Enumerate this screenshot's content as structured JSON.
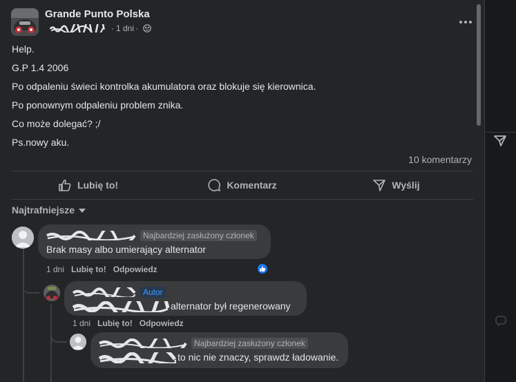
{
  "post": {
    "group_name": "Grande Punto Polska",
    "time": "1 dni",
    "separator": "·",
    "lines": [
      "Help.",
      "G.P 1.4 2006",
      "Po odpaleniu świeci kontrolka akumulatora oraz blokuje się kierownica.",
      "Po ponownym odpaleniu problem znika.",
      "Co może dolegać? ;/",
      "Ps.nowy aku."
    ],
    "comment_count": "10 komentarzy"
  },
  "actions": {
    "like": "Lubię to!",
    "comment": "Komentarz",
    "share": "Wyślij"
  },
  "sort_label": "Najtrafniejsze",
  "comments": [
    {
      "badge": "Najbardziej zasłużony członek",
      "text": "Brak masy albo umierający alternator",
      "time": "1 dni",
      "like": "Lubię to!",
      "reply": "Odpowiedz"
    },
    {
      "badge": "Autor",
      "text": "alternator był regenerowany",
      "time": "1 dni",
      "like": "Lubię to!",
      "reply": "Odpowiedz"
    },
    {
      "badge": "Najbardziej zasłużony członek",
      "text": "to nic nie znaczy, sprawdz ładowanie."
    }
  ],
  "colors": {
    "background": "#18191a",
    "card": "#242526",
    "bubble": "#3a3b3c",
    "text_primary": "#e4e6eb",
    "text_secondary": "#b0b3b8",
    "author_badge": "#4599ff",
    "like_blue": "#1877f2"
  }
}
